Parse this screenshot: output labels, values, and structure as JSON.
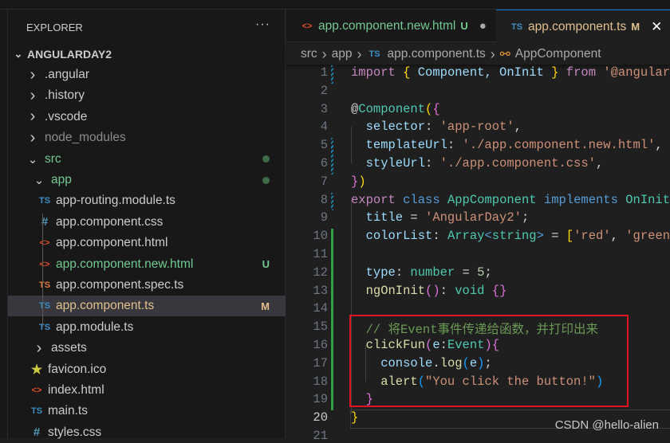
{
  "sidebar": {
    "title": "EXPLORER",
    "more": "···",
    "root": "ANGULARDAY2",
    "items": [
      {
        "label": ".angular",
        "type": "folder",
        "open": false,
        "depth": 1,
        "color": "#cccccc"
      },
      {
        "label": ".history",
        "type": "folder",
        "open": false,
        "depth": 1,
        "color": "#cccccc"
      },
      {
        "label": ".vscode",
        "type": "folder",
        "open": false,
        "depth": 1,
        "color": "#cccccc"
      },
      {
        "label": "node_modules",
        "type": "folder",
        "open": false,
        "depth": 1,
        "color": "#8c8c8c"
      },
      {
        "label": "src",
        "type": "folder",
        "open": true,
        "depth": 1,
        "color": "#73c991",
        "dot": true
      },
      {
        "label": "app",
        "type": "folder",
        "open": true,
        "depth": 2,
        "color": "#73c991",
        "dot": true
      },
      {
        "label": "app-routing.module.ts",
        "icon": "TS",
        "iconColor": "#3c8fc4",
        "depth": 3,
        "color": "#cccccc"
      },
      {
        "label": "app.component.css",
        "icon": "#",
        "iconColor": "#519aba",
        "depth": 3,
        "color": "#cccccc"
      },
      {
        "label": "app.component.html",
        "icon": "<>",
        "iconColor": "#e44d26",
        "depth": 3,
        "color": "#cccccc"
      },
      {
        "label": "app.component.new.html",
        "icon": "<>",
        "iconColor": "#e44d26",
        "depth": 3,
        "color": "#73c991",
        "badge": "U",
        "badgeColor": "#73c991"
      },
      {
        "label": "app.component.spec.ts",
        "icon": "TS",
        "iconColor": "#e37933",
        "depth": 3,
        "color": "#cccccc"
      },
      {
        "label": "app.component.ts",
        "icon": "TS",
        "iconColor": "#3c8fc4",
        "depth": 3,
        "color": "#e2c08d",
        "badge": "M",
        "badgeColor": "#e2c08d",
        "selected": true
      },
      {
        "label": "app.module.ts",
        "icon": "TS",
        "iconColor": "#3c8fc4",
        "depth": 3,
        "color": "#cccccc"
      },
      {
        "label": "assets",
        "type": "folder",
        "open": false,
        "depth": 2,
        "color": "#cccccc"
      },
      {
        "label": "favicon.ico",
        "icon": "★",
        "iconColor": "#cbcb41",
        "depth": 2,
        "color": "#cccccc"
      },
      {
        "label": "index.html",
        "icon": "<>",
        "iconColor": "#e44d26",
        "depth": 2,
        "color": "#cccccc"
      },
      {
        "label": "main.ts",
        "icon": "TS",
        "iconColor": "#3c8fc4",
        "depth": 2,
        "color": "#cccccc"
      },
      {
        "label": "styles.css",
        "icon": "#",
        "iconColor": "#519aba",
        "depth": 2,
        "color": "#cccccc"
      }
    ]
  },
  "tabs": [
    {
      "label": "app.component.new.html",
      "icon": "<>",
      "iconColor": "#e44d26",
      "color": "#73c991",
      "badge": "U",
      "state": "●"
    },
    {
      "label": "app.component.ts",
      "icon": "TS",
      "iconColor": "#3c8fc4",
      "color": "#e2c08d",
      "badge": "M",
      "state": "✕",
      "active": true
    }
  ],
  "breadcrumb": [
    "src",
    "app",
    "app.component.ts",
    "AppComponent"
  ],
  "colors": {
    "k": "#c586c0",
    "b": "#569cd6",
    "t": "#4ec9b0",
    "v": "#9cdcfe",
    "s": "#ce9178",
    "f": "#dcdcaa",
    "p": "#d4d4d4",
    "y": "#ffd700",
    "m": "#da70d6",
    "l": "#179fff",
    "c": "#6a9955",
    "n": "#b5cea8"
  },
  "code": [
    [
      [
        "import",
        "k"
      ],
      [
        " ",
        "p"
      ],
      [
        "{",
        "y"
      ],
      [
        " Component, OnInit ",
        "v"
      ],
      [
        "}",
        "y"
      ],
      [
        " ",
        "p"
      ],
      [
        "from",
        "k"
      ],
      [
        " '@angular/",
        "s"
      ]
    ],
    [],
    [
      [
        "@",
        "p"
      ],
      [
        "Component",
        "t"
      ],
      [
        "(",
        "y"
      ],
      [
        "{",
        "m"
      ]
    ],
    [
      [
        "  selector",
        "v"
      ],
      [
        ": ",
        "p"
      ],
      [
        "'app-root'",
        "s"
      ],
      [
        ",",
        "p"
      ]
    ],
    [
      [
        "  templateUrl",
        "v"
      ],
      [
        ": ",
        "p"
      ],
      [
        "'./app.component.new.html'",
        "s"
      ],
      [
        ",",
        "p"
      ]
    ],
    [
      [
        "  styleUrl",
        "v"
      ],
      [
        ": ",
        "p"
      ],
      [
        "'./app.component.css'",
        "s"
      ],
      [
        ",",
        "p"
      ]
    ],
    [
      [
        "}",
        "m"
      ],
      [
        ")",
        "y"
      ]
    ],
    [
      [
        "export",
        "k"
      ],
      [
        " ",
        "p"
      ],
      [
        "class",
        "b"
      ],
      [
        " ",
        "p"
      ],
      [
        "AppComponent",
        "t"
      ],
      [
        " ",
        "p"
      ],
      [
        "implements",
        "b"
      ],
      [
        " ",
        "p"
      ],
      [
        "OnInit",
        "t"
      ]
    ],
    [
      [
        "  title",
        "v"
      ],
      [
        " = ",
        "p"
      ],
      [
        "'AngularDay2'",
        "s"
      ],
      [
        ";",
        "p"
      ]
    ],
    [
      [
        "  colorList",
        "v"
      ],
      [
        ": ",
        "p"
      ],
      [
        "Array",
        "t"
      ],
      [
        "<",
        "b"
      ],
      [
        "string",
        "t"
      ],
      [
        ">",
        "b"
      ],
      [
        " = ",
        "p"
      ],
      [
        "[",
        "y"
      ],
      [
        "'red'",
        "s"
      ],
      [
        ", ",
        "p"
      ],
      [
        "'green'",
        "s"
      ]
    ],
    [],
    [
      [
        "  type",
        "v"
      ],
      [
        ": ",
        "p"
      ],
      [
        "number",
        "t"
      ],
      [
        " = ",
        "p"
      ],
      [
        "5",
        "n"
      ],
      [
        ";",
        "p"
      ]
    ],
    [
      [
        "  ngOnInit",
        "f"
      ],
      [
        "()",
        "m"
      ],
      [
        ": ",
        "p"
      ],
      [
        "void",
        "t"
      ],
      [
        " ",
        "p"
      ],
      [
        "{}",
        "m"
      ]
    ],
    [],
    [
      [
        "  // 将Event事件传递给函数，并打印出来",
        "c"
      ]
    ],
    [
      [
        "  clickFun",
        "f"
      ],
      [
        "(",
        "m"
      ],
      [
        "e",
        "v"
      ],
      [
        ":",
        "p"
      ],
      [
        "Event",
        "t"
      ],
      [
        ")",
        "m"
      ],
      [
        "{",
        "m"
      ]
    ],
    [
      [
        "    console",
        "v"
      ],
      [
        ".",
        "p"
      ],
      [
        "log",
        "f"
      ],
      [
        "(",
        "l"
      ],
      [
        "e",
        "v"
      ],
      [
        ")",
        "l"
      ],
      [
        ";",
        "p"
      ]
    ],
    [
      [
        "    alert",
        "f"
      ],
      [
        "(",
        "l"
      ],
      [
        "\"You click the button!\"",
        "s"
      ],
      [
        ")",
        "l"
      ]
    ],
    [
      [
        "  }",
        "m"
      ]
    ],
    [
      [
        "}",
        "y"
      ]
    ],
    []
  ],
  "current_line": 20,
  "watermark": "CSDN @hello-alien"
}
